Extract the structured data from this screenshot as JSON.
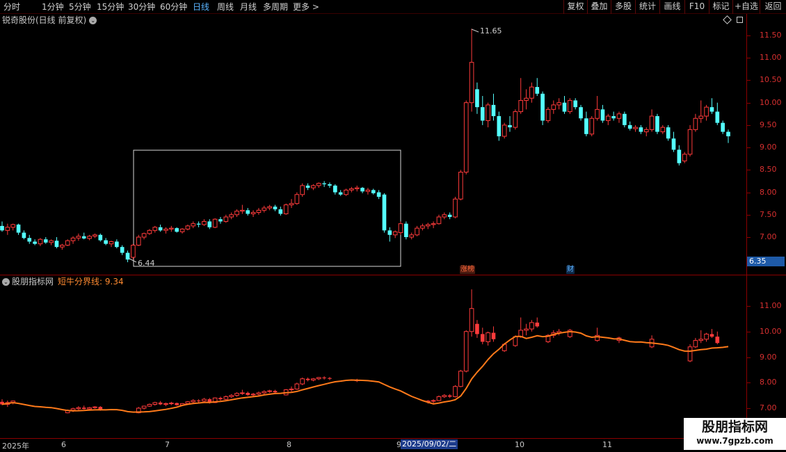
{
  "toolbar": {
    "periods": [
      "分时",
      "1分钟",
      "5分钟",
      "15分钟",
      "30分钟",
      "60分钟",
      "日线",
      "周线",
      "月线",
      "多周期",
      "更多 >"
    ],
    "active_period": "日线",
    "buttons": [
      "复权",
      "叠加",
      "多股",
      "统计",
      "画线",
      "F10",
      "标记",
      "+自选",
      "返回"
    ]
  },
  "chart": {
    "title": "锐奇股份(日线 前复权)",
    "high_label": "11.65",
    "low_label": "6.44",
    "current_price": "6.35",
    "marker_zhangbang": "涨榜",
    "marker_cai": "财",
    "price_ticks": [
      "11.50",
      "11.00",
      "10.50",
      "10.00",
      "9.50",
      "9.00",
      "8.50",
      "8.00",
      "7.50",
      "7.00"
    ]
  },
  "indicator": {
    "name": "股朋指标网",
    "line_label": "短牛分界线: 9.34",
    "ticks": [
      "11.00",
      "10.00",
      "9.00",
      "8.00",
      "7.00"
    ]
  },
  "date_axis": {
    "labels": [
      "2025年",
      "6",
      "7",
      "8",
      "9",
      "10",
      "11"
    ],
    "selected_date": "2025/09/02/二"
  },
  "watermark": {
    "brand": "股朋指标网",
    "url": "www.7gpzb.com"
  },
  "colors": {
    "up": "#ff3b3b",
    "down": "#54ffff",
    "ma_line": "#ff7a1a",
    "axis": "#8b0000"
  },
  "chart_data": {
    "type": "candlestick",
    "ylim": [
      6.3,
      11.8
    ],
    "candles": [
      [
        7.25,
        7.35,
        7.12,
        7.15
      ],
      [
        7.15,
        7.3,
        7.05,
        7.22
      ],
      [
        7.22,
        7.3,
        7.15,
        7.28
      ],
      [
        7.28,
        7.3,
        7.05,
        7.1
      ],
      [
        7.1,
        7.15,
        6.95,
        6.98
      ],
      [
        6.98,
        7.05,
        6.85,
        6.9
      ],
      [
        6.9,
        6.95,
        6.82,
        6.85
      ],
      [
        6.85,
        6.98,
        6.8,
        6.95
      ],
      [
        6.95,
        7.0,
        6.85,
        6.88
      ],
      [
        6.88,
        6.95,
        6.82,
        6.92
      ],
      [
        6.92,
        7.0,
        6.75,
        6.78
      ],
      [
        6.78,
        6.85,
        6.72,
        6.82
      ],
      [
        6.82,
        6.95,
        6.8,
        6.92
      ],
      [
        6.92,
        7.02,
        6.85,
        6.98
      ],
      [
        6.98,
        7.08,
        6.92,
        7.02
      ],
      [
        7.02,
        7.1,
        6.95,
        6.97
      ],
      [
        6.97,
        7.05,
        6.93,
        7.02
      ],
      [
        7.02,
        7.08,
        6.98,
        7.05
      ],
      [
        7.05,
        7.08,
        6.9,
        6.93
      ],
      [
        6.93,
        6.98,
        6.82,
        6.85
      ],
      [
        6.85,
        6.92,
        6.78,
        6.9
      ],
      [
        6.9,
        6.95,
        6.75,
        6.78
      ],
      [
        6.78,
        6.82,
        6.6,
        6.65
      ],
      [
        6.65,
        6.7,
        6.44,
        6.5
      ],
      [
        6.55,
        6.85,
        6.5,
        6.82
      ],
      [
        6.82,
        7.05,
        6.8,
        7.0
      ],
      [
        7.0,
        7.1,
        6.95,
        7.08
      ],
      [
        7.08,
        7.18,
        7.05,
        7.15
      ],
      [
        7.15,
        7.25,
        7.1,
        7.22
      ],
      [
        7.22,
        7.28,
        7.12,
        7.15
      ],
      [
        7.15,
        7.22,
        7.08,
        7.18
      ],
      [
        7.18,
        7.25,
        7.12,
        7.2
      ],
      [
        7.2,
        7.22,
        7.1,
        7.12
      ],
      [
        7.12,
        7.2,
        7.08,
        7.18
      ],
      [
        7.18,
        7.28,
        7.15,
        7.25
      ],
      [
        7.25,
        7.35,
        7.2,
        7.3
      ],
      [
        7.3,
        7.35,
        7.22,
        7.28
      ],
      [
        7.28,
        7.4,
        7.25,
        7.35
      ],
      [
        7.35,
        7.4,
        7.18,
        7.22
      ],
      [
        7.22,
        7.42,
        7.2,
        7.4
      ],
      [
        7.4,
        7.45,
        7.3,
        7.35
      ],
      [
        7.35,
        7.5,
        7.32,
        7.45
      ],
      [
        7.45,
        7.55,
        7.4,
        7.5
      ],
      [
        7.5,
        7.62,
        7.45,
        7.58
      ],
      [
        7.58,
        7.72,
        7.52,
        7.6
      ],
      [
        7.6,
        7.65,
        7.48,
        7.52
      ],
      [
        7.52,
        7.6,
        7.45,
        7.55
      ],
      [
        7.55,
        7.65,
        7.5,
        7.6
      ],
      [
        7.6,
        7.7,
        7.55,
        7.65
      ],
      [
        7.65,
        7.72,
        7.6,
        7.68
      ],
      [
        7.68,
        7.72,
        7.58,
        7.62
      ],
      [
        7.62,
        7.68,
        7.48,
        7.52
      ],
      [
        7.52,
        7.75,
        7.5,
        7.72
      ],
      [
        7.72,
        7.85,
        7.65,
        7.75
      ],
      [
        7.75,
        8.0,
        7.72,
        7.95
      ],
      [
        7.95,
        8.2,
        7.9,
        8.15
      ],
      [
        8.15,
        8.2,
        8.05,
        8.1
      ],
      [
        8.1,
        8.18,
        8.05,
        8.15
      ],
      [
        8.15,
        8.22,
        8.1,
        8.2
      ],
      [
        8.2,
        8.25,
        8.12,
        8.18
      ],
      [
        8.18,
        8.22,
        8.1,
        8.15
      ],
      [
        8.15,
        8.18,
        7.95,
        8.0
      ],
      [
        8.0,
        8.05,
        7.92,
        7.95
      ],
      [
        7.95,
        8.08,
        7.92,
        8.05
      ],
      [
        8.05,
        8.12,
        8.0,
        8.08
      ],
      [
        8.08,
        8.15,
        8.02,
        8.1
      ],
      [
        8.1,
        8.12,
        7.98,
        8.02
      ],
      [
        8.02,
        8.1,
        7.95,
        8.05
      ],
      [
        8.05,
        8.08,
        7.95,
        7.98
      ],
      [
        8.0,
        8.05,
        7.85,
        7.9
      ],
      [
        7.95,
        7.98,
        7.1,
        7.15
      ],
      [
        7.15,
        7.22,
        6.9,
        7.05
      ],
      [
        7.05,
        7.15,
        6.98,
        7.12
      ],
      [
        7.1,
        7.35,
        7.05,
        7.3
      ],
      [
        7.3,
        7.35,
        6.95,
        7.0
      ],
      [
        7.0,
        7.1,
        6.95,
        7.05
      ],
      [
        7.05,
        7.25,
        7.02,
        7.2
      ],
      [
        7.2,
        7.3,
        7.15,
        7.25
      ],
      [
        7.25,
        7.32,
        7.18,
        7.28
      ],
      [
        7.28,
        7.35,
        7.2,
        7.3
      ],
      [
        7.3,
        7.5,
        7.28,
        7.45
      ],
      [
        7.45,
        7.55,
        7.4,
        7.5
      ],
      [
        7.5,
        7.55,
        7.4,
        7.45
      ],
      [
        7.45,
        7.9,
        7.42,
        7.85
      ],
      [
        7.85,
        8.5,
        7.82,
        8.45
      ],
      [
        8.45,
        10.05,
        8.4,
        10.0
      ],
      [
        10.0,
        11.65,
        9.8,
        10.9
      ],
      [
        10.3,
        10.45,
        9.75,
        9.9
      ],
      [
        9.9,
        10.15,
        9.5,
        9.6
      ],
      [
        9.6,
        10.0,
        9.45,
        9.95
      ],
      [
        9.95,
        10.2,
        9.6,
        9.7
      ],
      [
        9.7,
        9.8,
        9.15,
        9.25
      ],
      [
        9.25,
        9.55,
        9.2,
        9.5
      ],
      [
        9.5,
        9.7,
        9.35,
        9.45
      ],
      [
        9.45,
        9.85,
        9.4,
        9.8
      ],
      [
        9.8,
        10.55,
        9.75,
        10.05
      ],
      [
        10.05,
        10.3,
        9.85,
        10.1
      ],
      [
        10.1,
        10.45,
        10.0,
        10.35
      ],
      [
        10.35,
        10.55,
        10.15,
        10.2
      ],
      [
        10.2,
        10.25,
        9.5,
        9.6
      ],
      [
        9.6,
        9.9,
        9.55,
        9.85
      ],
      [
        9.85,
        10.05,
        9.75,
        9.95
      ],
      [
        9.95,
        10.1,
        9.85,
        10.0
      ],
      [
        10.0,
        10.15,
        9.75,
        9.8
      ],
      [
        9.8,
        10.1,
        9.75,
        10.05
      ],
      [
        10.05,
        10.1,
        9.85,
        9.9
      ],
      [
        9.9,
        9.95,
        9.6,
        9.65
      ],
      [
        9.65,
        9.8,
        9.25,
        9.3
      ],
      [
        9.3,
        9.7,
        9.25,
        9.65
      ],
      [
        9.65,
        10.15,
        9.6,
        9.85
      ],
      [
        9.85,
        9.95,
        9.55,
        9.6
      ],
      [
        9.6,
        9.75,
        9.5,
        9.7
      ],
      [
        9.7,
        9.8,
        9.6,
        9.65
      ],
      [
        9.65,
        9.8,
        9.55,
        9.75
      ],
      [
        9.75,
        9.8,
        9.45,
        9.5
      ],
      [
        9.5,
        9.58,
        9.38,
        9.42
      ],
      [
        9.42,
        9.5,
        9.35,
        9.45
      ],
      [
        9.45,
        9.5,
        9.3,
        9.35
      ],
      [
        9.35,
        9.45,
        9.25,
        9.4
      ],
      [
        9.4,
        9.85,
        9.35,
        9.7
      ],
      [
        9.7,
        9.75,
        9.3,
        9.35
      ],
      [
        9.35,
        9.5,
        9.3,
        9.45
      ],
      [
        9.45,
        9.5,
        9.15,
        9.2
      ],
      [
        9.2,
        9.35,
        8.9,
        8.95
      ],
      [
        8.95,
        9.05,
        8.6,
        8.65
      ],
      [
        8.7,
        8.9,
        8.65,
        8.85
      ],
      [
        8.85,
        9.5,
        8.8,
        9.4
      ],
      [
        9.4,
        9.75,
        9.35,
        9.65
      ],
      [
        9.65,
        10.05,
        9.55,
        9.7
      ],
      [
        9.7,
        9.95,
        9.6,
        9.9
      ],
      [
        9.9,
        10.1,
        9.75,
        9.8
      ],
      [
        9.8,
        10.0,
        9.5,
        9.55
      ],
      [
        9.55,
        9.6,
        9.3,
        9.35
      ],
      [
        9.35,
        9.4,
        9.1,
        9.25
      ]
    ],
    "ma_line": {
      "name": "短牛分界线",
      "last_value": 9.34
    }
  }
}
